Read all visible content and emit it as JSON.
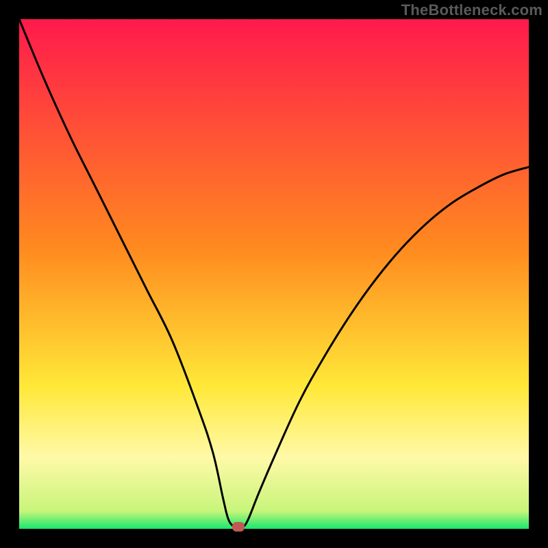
{
  "watermark": {
    "text": "TheBottleneck.com"
  },
  "colors": {
    "black": "#000000",
    "red": "#ff1a4c",
    "orange": "#ff8a1f",
    "yellow": "#ffe838",
    "paleYellow": "#fff9a8",
    "green": "#17e86f",
    "curve": "#000000",
    "marker": "#c15a55"
  },
  "chart_data": {
    "type": "line",
    "title": "",
    "xlabel": "",
    "ylabel": "",
    "xlim": [
      0,
      100
    ],
    "ylim": [
      0,
      100
    ],
    "grid": false,
    "legend": false,
    "notes": "Bottleneck-style plot: background vertical gradient red→orange→yellow→green; single black V-shaped curve reaching minimum near x≈43; small rounded marker at the minimum.",
    "series": [
      {
        "name": "bottleneck-curve",
        "x": [
          0,
          5,
          10,
          15,
          20,
          25,
          30,
          35,
          38,
          40,
          41,
          42,
          43,
          44,
          45,
          47,
          50,
          55,
          60,
          65,
          70,
          75,
          80,
          85,
          90,
          95,
          100
        ],
        "y": [
          100,
          88,
          77,
          67,
          57,
          47,
          37,
          24,
          15,
          6,
          2,
          0.5,
          0,
          0.4,
          2,
          7,
          14,
          25,
          34,
          42,
          49,
          55,
          60,
          64,
          67,
          69.5,
          71
        ]
      }
    ],
    "marker": {
      "x": 43,
      "y": 0
    },
    "background_gradient_stops": [
      {
        "pos": 0.0,
        "color": "#ff1a4c"
      },
      {
        "pos": 0.45,
        "color": "#ff8a1f"
      },
      {
        "pos": 0.72,
        "color": "#ffe838"
      },
      {
        "pos": 0.86,
        "color": "#fff9a8"
      },
      {
        "pos": 0.965,
        "color": "#c8f57a"
      },
      {
        "pos": 1.0,
        "color": "#17e86f"
      }
    ]
  }
}
